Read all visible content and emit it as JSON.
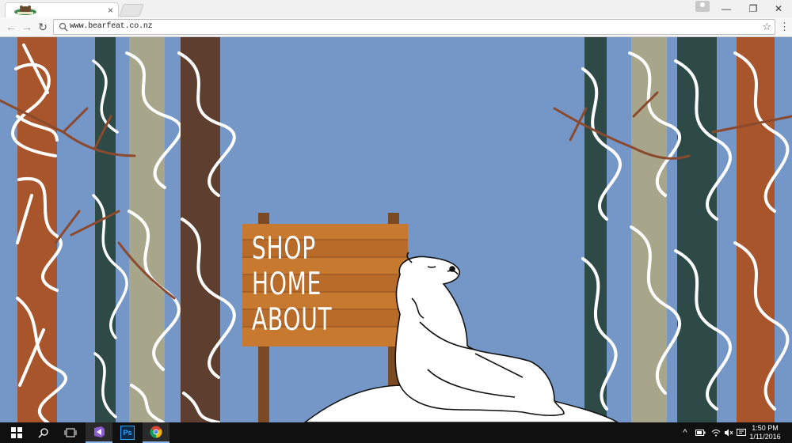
{
  "browser": {
    "tab": {
      "favicon": "bear-logo-icon",
      "close_glyph": "×"
    },
    "window_controls": {
      "minimize": "—",
      "maximize": "❐",
      "close": "✕"
    },
    "nav": {
      "back": "←",
      "forward": "→",
      "reload": "↻"
    },
    "address": {
      "url": "www.bearfeat.co.nz"
    },
    "bookmark_glyph": "☆",
    "menu_glyph": "⋮"
  },
  "site": {
    "nav": [
      {
        "label": "SHOP"
      },
      {
        "label": "HOME"
      },
      {
        "label": "ABOUT"
      }
    ],
    "colors": {
      "sky": "#7497c7",
      "rust": "#a9552b",
      "dark_green": "#2e4a47",
      "khaki": "#a8a68a",
      "brown": "#5e3f2f",
      "sign_wood": "#c7792f"
    }
  },
  "taskbar": {
    "icons": [
      "windows-start-icon",
      "search-icon",
      "task-view-icon",
      "visual-studio-icon",
      "photoshop-icon",
      "chrome-icon"
    ],
    "photoshop_label": "Ps",
    "tray_icons": [
      "chevron-up-icon",
      "battery-icon",
      "wifi-icon",
      "volume-muted-icon",
      "notification-icon"
    ],
    "time": "1:50 PM",
    "date": "1/11/2016"
  }
}
